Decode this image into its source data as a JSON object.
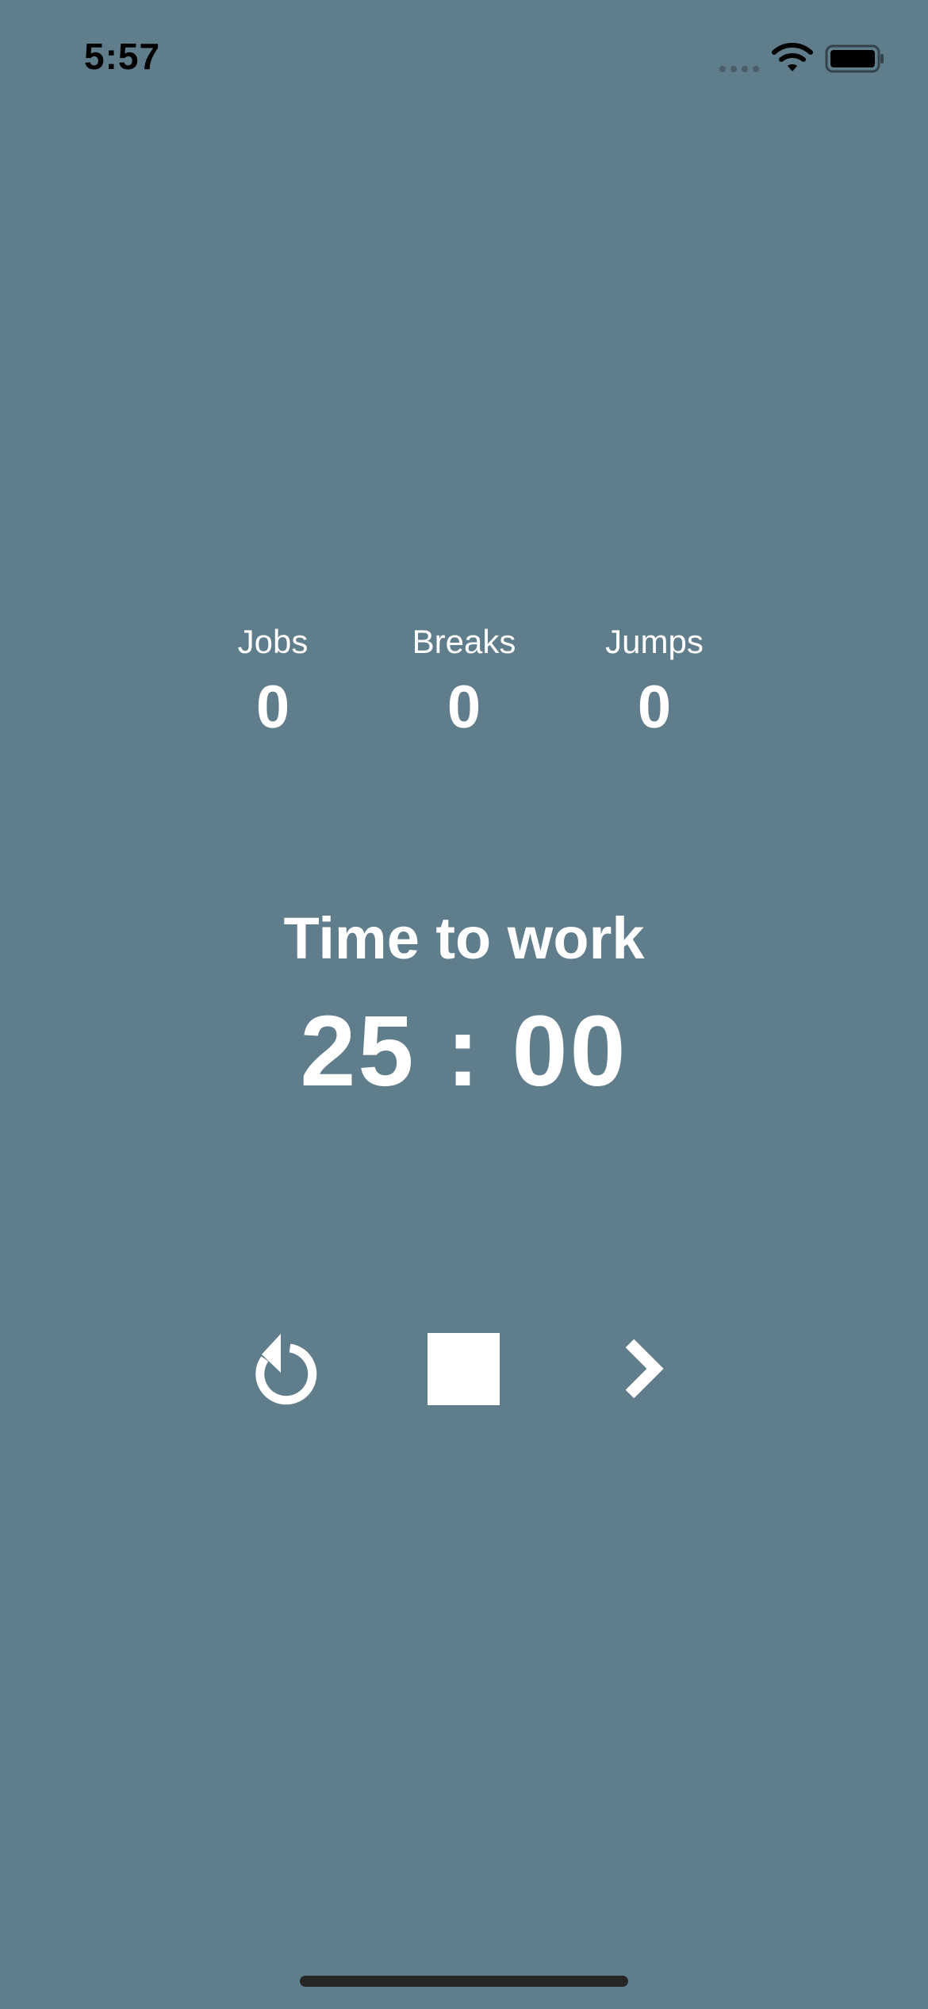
{
  "status_bar": {
    "time": "5:57",
    "icons": [
      "signal-icon",
      "wifi-icon",
      "battery-icon"
    ]
  },
  "stats": [
    {
      "label": "Jobs",
      "value": "0"
    },
    {
      "label": "Breaks",
      "value": "0"
    },
    {
      "label": "Jumps",
      "value": "0"
    }
  ],
  "phase": {
    "title": "Time to work",
    "timer": "25 : 00"
  },
  "controls": {
    "icons": [
      "reset-icon",
      "stop-icon",
      "skip-icon"
    ]
  },
  "colors": {
    "background": "#607d8b",
    "foreground": "#ffffff",
    "status_text": "#000000",
    "home_indicator": "#262626"
  }
}
